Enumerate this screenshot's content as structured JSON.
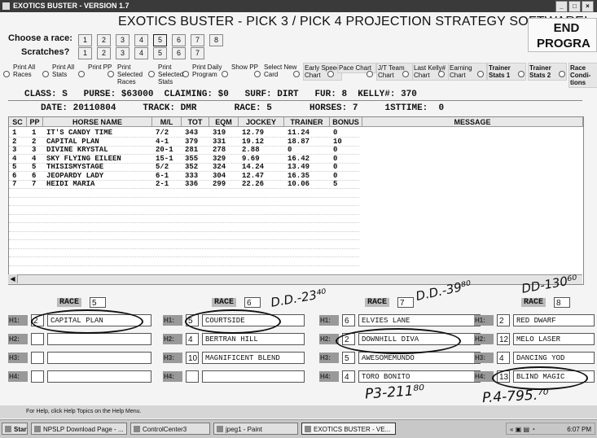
{
  "window": {
    "title": "EXOTICS BUSTER - VERSION 1.7",
    "app_title": "EXOTICS BUSTER - PICK 3 / PICK 4 PROJECTION STRATEGY SOFTWARE!",
    "end_label_1": "END",
    "end_label_2": "PROGRA"
  },
  "controls": {
    "choose_label": "Choose  a race:",
    "scratches_label": "Scratches?",
    "race_buttons": [
      "1",
      "2",
      "3",
      "4",
      "5",
      "6",
      "7",
      "8"
    ],
    "scratch_buttons": [
      "1",
      "2",
      "3",
      "4",
      "5",
      "6",
      "7"
    ]
  },
  "options": [
    "Print All Races",
    "Print All Stats",
    "Print PP",
    "Print Selected Races",
    "Print Selected Stats",
    "Print Daily Program",
    "Show PP",
    "Select New Card",
    "Early Speed Chart",
    "Pace Chart",
    "J/T Team Chart",
    "Last Kelly# Chart",
    "Earning Chart",
    "Trainer Stats 1",
    "Trainer Stats 2",
    "Race Condi-tions"
  ],
  "info": {
    "line1": "CLASS: S   PURSE: $63000  CLAIMING: $0   SURF: DIRT   FUR: 8  KELLY#: 370",
    "line2": "DATE: 20110804     TRACK: DMR       RACE: 5       HORSES: 7     1STTIME:  0"
  },
  "table": {
    "headers": [
      "SC",
      "PP",
      "HORSE NAME",
      "M/L",
      "TOT",
      "EQM",
      "JOCKEY",
      "TRAINER",
      "BONUS",
      "MESSAGE"
    ],
    "rows": [
      [
        "1",
        "1",
        "IT'S CANDY TIME",
        "7/2",
        "343",
        "319",
        "12.79",
        "11.24",
        "0"
      ],
      [
        "2",
        "2",
        "CAPITAL PLAN",
        "4-1",
        "379",
        "331",
        "19.12",
        "18.87",
        "10"
      ],
      [
        "3",
        "3",
        "DIVINE KRYSTAL",
        "20-1",
        "281",
        "278",
        "2.88",
        "0",
        "0"
      ],
      [
        "4",
        "4",
        "SKY FLYING EILEEN",
        "15-1",
        "355",
        "329",
        "9.69",
        "16.42",
        "0"
      ],
      [
        "5",
        "5",
        "THISISMYSTAGE",
        "5/2",
        "352",
        "324",
        "14.24",
        "13.49",
        "0"
      ],
      [
        "6",
        "6",
        "JEOPARDY LADY",
        "6-1",
        "333",
        "304",
        "12.47",
        "16.35",
        "0"
      ],
      [
        "7",
        "7",
        "HEIDI MARIA",
        "2-1",
        "336",
        "299",
        "22.26",
        "10.06",
        "5"
      ]
    ]
  },
  "races": [
    {
      "label": "RACE",
      "number": "5",
      "picks": [
        {
          "h": "H1:",
          "n": "2",
          "name": "CAPITAL PLAN"
        },
        {
          "h": "H2:",
          "n": "",
          "name": ""
        },
        {
          "h": "H3:",
          "n": "",
          "name": ""
        },
        {
          "h": "H4:",
          "n": "",
          "name": ""
        }
      ]
    },
    {
      "label": "RACE",
      "number": "6",
      "picks": [
        {
          "h": "H1:",
          "n": "5",
          "name": "COURTSIDE"
        },
        {
          "h": "H2:",
          "n": "4",
          "name": "BERTRAN HILL"
        },
        {
          "h": "H3:",
          "n": "10",
          "name": "MAGNIFICENT BLEND"
        },
        {
          "h": "H4:",
          "n": "",
          "name": ""
        }
      ]
    },
    {
      "label": "RACE",
      "number": "7",
      "picks": [
        {
          "h": "H1:",
          "n": "6",
          "name": "ELVIES LANE"
        },
        {
          "h": "H2:",
          "n": "2",
          "name": "DOWNHILL DIVA"
        },
        {
          "h": "H3:",
          "n": "5",
          "name": "AWESOMEMUNDO"
        },
        {
          "h": "H4:",
          "n": "4",
          "name": "TORO BONITO"
        }
      ]
    },
    {
      "label": "RACE",
      "number": "8",
      "picks": [
        {
          "h": "H1:",
          "n": "2",
          "name": "RED DWARF"
        },
        {
          "h": "H2:",
          "n": "12",
          "name": "MELO LASER"
        },
        {
          "h": "H3:",
          "n": "4",
          "name": "DANCING YOD"
        },
        {
          "h": "H4:",
          "n": "13",
          "name": "BLIND MAGIC"
        }
      ]
    }
  ],
  "handwriting": {
    "r6": "D.D.-23⁴⁰",
    "r7": "D.D.-39⁸⁰",
    "r8": "DD-130⁶⁰",
    "p3": "P3-211⁸⁰",
    "p4": "P.4-795.⁷⁰"
  },
  "status": {
    "help": "For Help, click Help Topics on the Help Menu."
  },
  "taskbar": {
    "start": "Start",
    "tasks": [
      "NPSLP Download Page - ...",
      "ControlCenter3",
      "jpeg1 - Paint",
      "EXOTICS BUSTER - VE..."
    ],
    "time": "6:07 PM"
  }
}
